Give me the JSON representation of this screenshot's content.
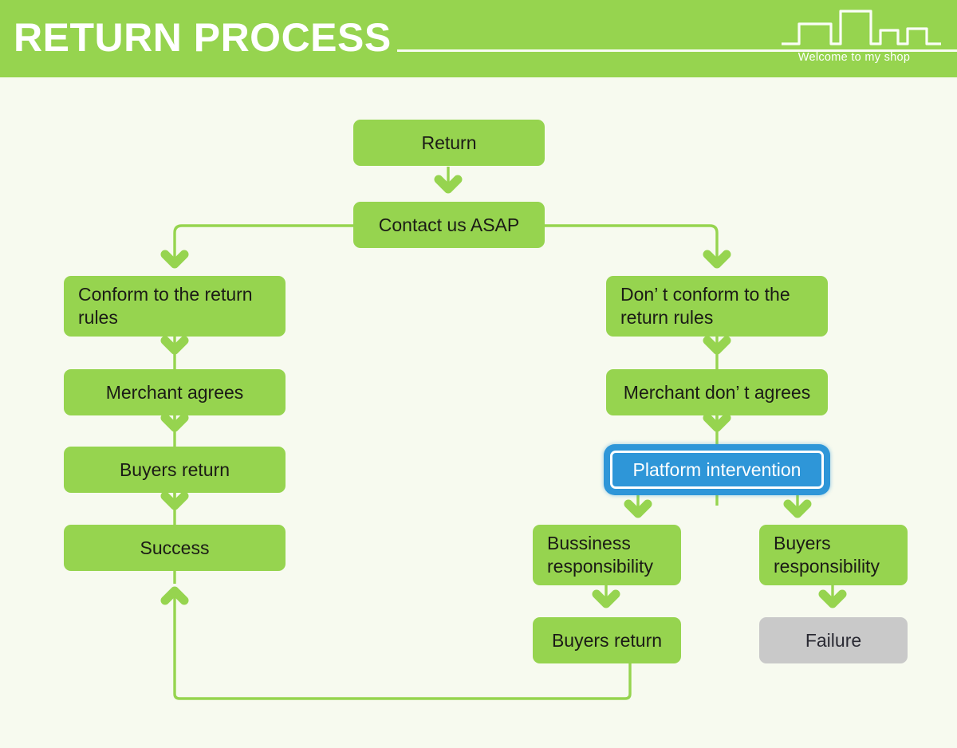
{
  "header": {
    "title": "RETURN PROCESS",
    "tagline": "Welcome to my shop",
    "skyline_icon": "city-skyline-icon",
    "banner_color": "#96d44f",
    "title_color": "#ffffff"
  },
  "theme": {
    "background": "#f7faef",
    "node_green": "#96d44f",
    "node_gray": "#c9c9c9",
    "highlight_blue": "#2e96d8",
    "connector_green": "#96d44f",
    "text_dark": "#1b1b16"
  },
  "flow": {
    "title": "Return Process",
    "nodes": [
      {
        "id": "return",
        "label": "Return",
        "style": "green",
        "align": "center"
      },
      {
        "id": "contact",
        "label": "Contact us ASAP",
        "style": "green",
        "align": "center"
      },
      {
        "id": "conform",
        "label": "Conform to the return rules",
        "style": "green",
        "align": "left"
      },
      {
        "id": "merchant-agrees",
        "label": "Merchant agrees",
        "style": "green",
        "align": "center"
      },
      {
        "id": "buyers-return-left",
        "label": "Buyers return",
        "style": "green",
        "align": "center"
      },
      {
        "id": "success",
        "label": "Success",
        "style": "green",
        "align": "center"
      },
      {
        "id": "not-conform",
        "label": "Don’ t conform to the return rules",
        "style": "green",
        "align": "left"
      },
      {
        "id": "merchant-disagrees",
        "label": "Merchant don’ t agrees",
        "style": "green",
        "align": "center"
      },
      {
        "id": "platform",
        "label": "Platform intervention",
        "style": "highlight",
        "align": "center"
      },
      {
        "id": "business-resp",
        "label": "Bussiness responsibility",
        "style": "green",
        "align": "left"
      },
      {
        "id": "buyers-resp",
        "label": "Buyers responsibility",
        "style": "green",
        "align": "left"
      },
      {
        "id": "buyers-return-right",
        "label": "Buyers return",
        "style": "green",
        "align": "center"
      },
      {
        "id": "failure",
        "label": "Failure",
        "style": "gray",
        "align": "center"
      }
    ],
    "edges": [
      {
        "from": "return",
        "to": "contact",
        "kind": "straight-down"
      },
      {
        "from": "contact",
        "to": "conform",
        "kind": "left-branch"
      },
      {
        "from": "contact",
        "to": "not-conform",
        "kind": "right-branch"
      },
      {
        "from": "conform",
        "to": "merchant-agrees",
        "kind": "straight-down"
      },
      {
        "from": "merchant-agrees",
        "to": "buyers-return-left",
        "kind": "straight-down"
      },
      {
        "from": "buyers-return-left",
        "to": "success",
        "kind": "straight-down"
      },
      {
        "from": "not-conform",
        "to": "merchant-disagrees",
        "kind": "straight-down"
      },
      {
        "from": "merchant-disagrees",
        "to": "platform",
        "kind": "straight-down"
      },
      {
        "from": "platform",
        "to": "business-resp",
        "kind": "split-left"
      },
      {
        "from": "platform",
        "to": "buyers-resp",
        "kind": "split-right"
      },
      {
        "from": "business-resp",
        "to": "buyers-return-right",
        "kind": "straight-down"
      },
      {
        "from": "buyers-resp",
        "to": "failure",
        "kind": "straight-down"
      },
      {
        "from": "buyers-return-right",
        "to": "success",
        "kind": "feedback-loop-up"
      }
    ]
  }
}
